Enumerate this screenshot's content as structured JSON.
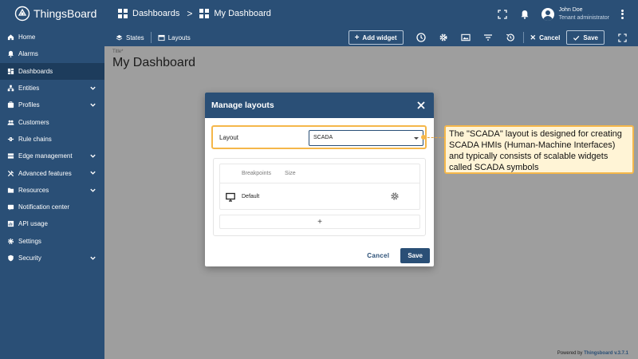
{
  "app": {
    "logo_text": "ThingsBoard"
  },
  "breadcrumb": {
    "parent": "Dashboards",
    "separator": ">",
    "current": "My Dashboard"
  },
  "user": {
    "name": "John Doe",
    "role": "Tenant administrator"
  },
  "sidebar": {
    "items": [
      {
        "label": "Home",
        "icon": "home-icon",
        "has_chevron": false
      },
      {
        "label": "Alarms",
        "icon": "alarm-icon",
        "has_chevron": false
      },
      {
        "label": "Dashboards",
        "icon": "dashboard-icon",
        "has_chevron": false,
        "active": true
      },
      {
        "label": "Entities",
        "icon": "entities-icon",
        "has_chevron": true
      },
      {
        "label": "Profiles",
        "icon": "profiles-icon",
        "has_chevron": true
      },
      {
        "label": "Customers",
        "icon": "customers-icon",
        "has_chevron": false
      },
      {
        "label": "Rule chains",
        "icon": "rule-chains-icon",
        "has_chevron": false
      },
      {
        "label": "Edge management",
        "icon": "edge-icon",
        "has_chevron": true
      },
      {
        "label": "Advanced features",
        "icon": "advanced-icon",
        "has_chevron": true
      },
      {
        "label": "Resources",
        "icon": "resources-icon",
        "has_chevron": true
      },
      {
        "label": "Notification center",
        "icon": "notification-icon",
        "has_chevron": false
      },
      {
        "label": "API usage",
        "icon": "api-usage-icon",
        "has_chevron": false
      },
      {
        "label": "Settings",
        "icon": "settings-icon",
        "has_chevron": false
      },
      {
        "label": "Security",
        "icon": "security-icon",
        "has_chevron": true
      }
    ]
  },
  "toolbar": {
    "states_label": "States",
    "layouts_label": "Layouts",
    "add_widget_label": "Add widget",
    "cancel_label": "Cancel",
    "save_label": "Save"
  },
  "main": {
    "title_hint": "Title*",
    "title": "My Dashboard",
    "powered_prefix": "Powered by",
    "powered_brand": "Thingsboard v.3.7.1"
  },
  "dialog": {
    "title": "Manage layouts",
    "layout_label": "Layout",
    "layout_value": "SCADA",
    "columns": [
      "Breakpoints",
      "Size"
    ],
    "rows": [
      {
        "name": "Default"
      }
    ],
    "add_symbol": "+",
    "cancel_label": "Cancel",
    "save_label": "Save"
  },
  "callout": {
    "text": "The \"SCADA\" layout is designed for creating SCADA HMIs (Human-Machine Interfaces) and typically consists of scalable widgets called SCADA symbols"
  },
  "colors": {
    "primary": "#2a4f76",
    "callout_border": "#f5b74a",
    "callout_bg": "#fff4d6"
  }
}
